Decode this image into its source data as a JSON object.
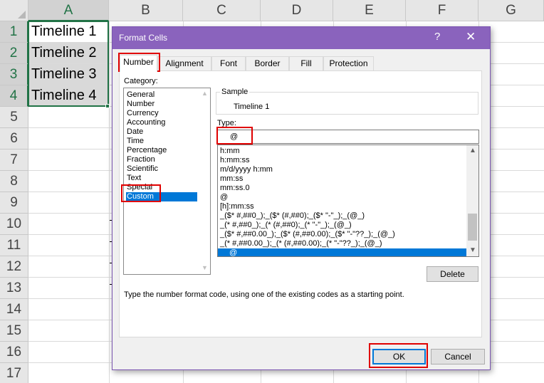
{
  "sheet": {
    "columns": [
      "A",
      "B",
      "C",
      "D",
      "E",
      "F",
      "G"
    ],
    "rows": [
      "1",
      "2",
      "3",
      "4",
      "5",
      "6",
      "7",
      "8",
      "9",
      "10",
      "11",
      "12",
      "13",
      "14",
      "15",
      "16",
      "17"
    ],
    "cells": [
      "Timeline 1",
      "Timeline 2",
      "Timeline 3",
      "Timeline 4"
    ]
  },
  "dialog": {
    "title": "Format Cells",
    "help_glyph": "?",
    "close_glyph": "✕",
    "tabs": [
      "Number",
      "Alignment",
      "Font",
      "Border",
      "Fill",
      "Protection"
    ],
    "active_tab": "Number",
    "category": {
      "label": "Category:",
      "items": [
        "General",
        "Number",
        "Currency",
        "Accounting",
        "Date",
        "Time",
        "Percentage",
        "Fraction",
        "Scientific",
        "Text",
        "Special",
        "Custom"
      ],
      "selected": "Custom"
    },
    "sample": {
      "label": "Sample",
      "value": "Timeline 1"
    },
    "type": {
      "label": "Type:",
      "value": "@",
      "items": [
        "h:mm",
        "h:mm:ss",
        "m/d/yyyy h:mm",
        "mm:ss",
        "mm:ss.0",
        "@",
        "[h]:mm:ss",
        "_($* #,##0_);_($* (#,##0);_($* \"-\"_);_(@_)",
        "_(* #,##0_);_(* (#,##0);_(* \"-\"_);_(@_)",
        "_($* #,##0.00_);_($* (#,##0.00);_($* \"-\"??_);_(@_)",
        "_(* #,##0.00_);_(* (#,##0.00);_(* \"-\"??_);_(@_)",
        "@"
      ],
      "selected_index": 11
    },
    "delete_label": "Delete",
    "hint": "Type the number format code, using one of the existing codes as a starting point.",
    "ok_label": "OK",
    "cancel_label": "Cancel"
  },
  "colors": {
    "titlebar": "#8a63bd",
    "selection": "#0078d7",
    "highlight_box": "#e00000",
    "excel_green": "#217346"
  }
}
